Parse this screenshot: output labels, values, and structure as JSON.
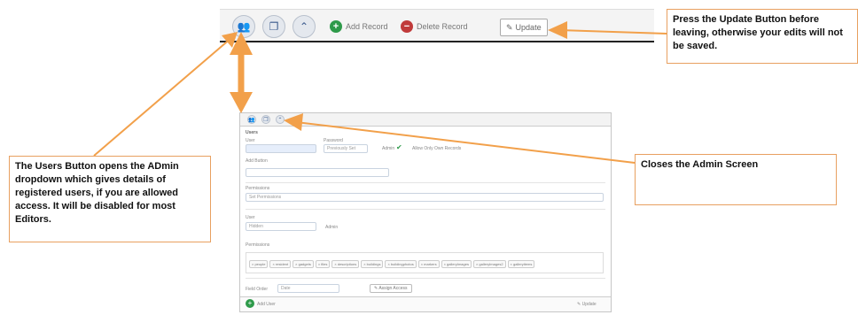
{
  "toolbar": {
    "add_record": "Add Record",
    "delete_record": "Delete Record",
    "update": "Update"
  },
  "notes": {
    "update_note": "Press the Update Button before leaving, otherwise your edits will not be saved.",
    "users_note": "The Users Button opens the ADmin dropdown which gives details of registered users, if you are allowed access. It will be disabled for most Editors.",
    "close_note": "Closes the Admin Screen"
  },
  "admin": {
    "section_title": "Users",
    "user_label": "User",
    "password_label": "Password",
    "password_value": "Previously Set",
    "admin_label": "Admin",
    "only_records_label": "Allow Only Own Records",
    "add_button": "Add Button",
    "permissions_label": "Permissions",
    "permissions_value": "Set Permissions",
    "user2_label": "User",
    "user2_value": "Hidden",
    "admin2_label": "Admin",
    "permissions2_label": "Permissions",
    "perm_tags": [
      "people",
      "resident",
      "gadgets",
      "files",
      "descriptions",
      "buildings",
      "buildingphotos",
      "markers",
      "galleryImages",
      "galleryImages2",
      "galleryitems"
    ],
    "field_label": "Field Order",
    "field_value": "Date",
    "assign_button": "Assign Access",
    "add_user": "Add User",
    "update": "Update"
  },
  "colors": {
    "arrow": "#f2a04a",
    "note_border": "#e8a060",
    "add_green": "#2e9a4a",
    "delete_red": "#c03a3a"
  }
}
